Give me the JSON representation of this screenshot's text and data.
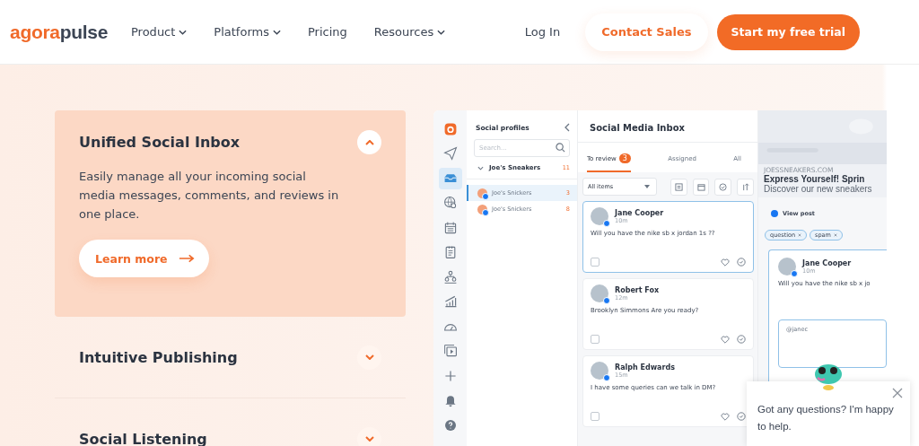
{
  "nav": {
    "logo": [
      "agora",
      "pulse"
    ],
    "menu": [
      {
        "label": "Product",
        "dropdown": true
      },
      {
        "label": "Platforms",
        "dropdown": true
      },
      {
        "label": "Pricing",
        "dropdown": false
      },
      {
        "label": "Resources",
        "dropdown": true
      }
    ],
    "login": "Log In",
    "contact": "Contact Sales",
    "trial": "Start my free trial"
  },
  "features": [
    {
      "title": "Unified Social Inbox",
      "expanded": true,
      "description": "Easily manage all your incoming social media messages, comments, and reviews in one place.",
      "button": "Learn more"
    },
    {
      "title": "Intuitive Publishing",
      "expanded": false
    },
    {
      "title": "Social Listening",
      "expanded": false
    }
  ],
  "app": {
    "rail": [
      {
        "kind": "logo",
        "selected": false
      },
      {
        "kind": "send",
        "selected": false
      },
      {
        "kind": "inbox",
        "selected": true
      },
      {
        "kind": "globe",
        "selected": false
      },
      {
        "kind": "calendar",
        "selected": false
      },
      {
        "kind": "list",
        "selected": false
      },
      {
        "kind": "org",
        "selected": false
      },
      {
        "kind": "chart",
        "selected": false
      },
      {
        "kind": "gauge",
        "selected": false
      },
      {
        "kind": "video",
        "selected": false
      },
      {
        "kind": "plus",
        "selected": false
      },
      {
        "kind": "bell",
        "selected": false
      },
      {
        "kind": "help",
        "selected": false
      }
    ],
    "profiles": {
      "title": "Social profiles",
      "search_placeholder": "Search...",
      "group": {
        "name": "Joe's Sneakers",
        "count": "11",
        "expanded": true
      },
      "items": [
        {
          "name": "Joe's Snickers",
          "count": "3",
          "selected": true
        },
        {
          "name": "Joe's Snickers",
          "count": "8",
          "selected": false
        }
      ]
    },
    "inbox": {
      "title": "Social Media Inbox",
      "tabs": [
        {
          "label": "To review",
          "badge": "3",
          "selected": true
        },
        {
          "label": "Assigned",
          "selected": false
        },
        {
          "label": "All",
          "selected": false
        }
      ],
      "filter": "All items",
      "messages": [
        {
          "name": "Jane Cooper",
          "time": "10m",
          "text": "Will you have the nike sb x jordan 1s ??",
          "selected": true
        },
        {
          "name": "Robert Fox",
          "time": "12m",
          "text": "Brooklyn Simmons Are you ready?",
          "selected": false
        },
        {
          "name": "Ralph Edwards",
          "time": "15m",
          "text": "I have some queries can we talk in DM?",
          "selected": false
        }
      ]
    },
    "detail": {
      "domain": "JOESSNEAKERS.COM",
      "headline": "Express Yourself! Sprin",
      "subtitle": "Discover our new sneakers",
      "view_post": "View post",
      "tags": [
        "question",
        "spam"
      ],
      "reply": {
        "name": "Jane Cooper",
        "time": "10m",
        "text": "Will you have the nike sb x jo",
        "mention": "@janec"
      }
    }
  },
  "chat": {
    "text": "Got any questions? I'm happy to help."
  }
}
